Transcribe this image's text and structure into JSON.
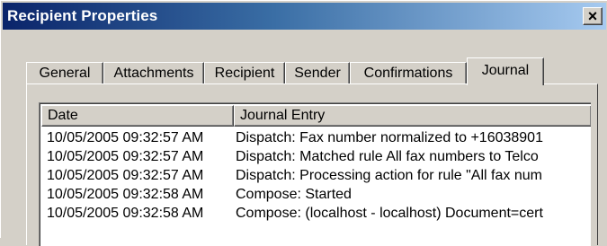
{
  "window": {
    "title": "Recipient Properties",
    "close_glyph": "×"
  },
  "tabs": [
    {
      "label": "General"
    },
    {
      "label": "Attachments"
    },
    {
      "label": "Recipient"
    },
    {
      "label": "Sender"
    },
    {
      "label": "Confirmations"
    },
    {
      "label": "Journal",
      "active": true
    }
  ],
  "journal": {
    "columns": [
      "Date",
      "Journal Entry"
    ],
    "rows": [
      {
        "date": "10/05/2005 09:32:57 AM",
        "entry": "Dispatch: Fax number normalized to +16038901"
      },
      {
        "date": "10/05/2005 09:32:57 AM",
        "entry": "Dispatch: Matched rule All fax numbers to Telco"
      },
      {
        "date": "10/05/2005 09:32:57 AM",
        "entry": "Dispatch: Processing action for rule \"All fax num"
      },
      {
        "date": "10/05/2005 09:32:58 AM",
        "entry": "Compose: Started"
      },
      {
        "date": "10/05/2005 09:32:58 AM",
        "entry": "Compose: (localhost - localhost) Document=cert"
      }
    ]
  },
  "colors": {
    "title_start": "#0a246a",
    "title_end": "#a6caf0",
    "face": "#d4d0c8"
  }
}
